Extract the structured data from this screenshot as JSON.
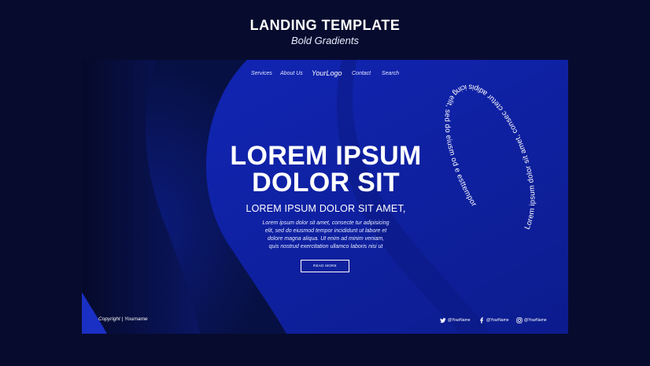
{
  "showcase": {
    "title": "LANDING TEMPLATE",
    "subtitle": "Bold Gradients"
  },
  "nav": {
    "items": [
      "Services",
      "About Us",
      "Contact",
      "Search"
    ],
    "logo": "YourLogo"
  },
  "hero": {
    "title_line1": "LOREM IPSUM",
    "title_line2": "DOLOR SIT",
    "subtitle": "LOREM IPSUM DOLOR SIT AMET,",
    "body_lines": [
      "Lorem ipsum dolor sit amet, consecte tur adipisicing",
      "elit, sed do eiusmod tempor incididunt ut labore et",
      "dolore magna aliqua. Ut enim ad minim veniam,",
      "quis nostrud exercitation ullamco laboris nisi ut"
    ],
    "cta_label": "READ MORE"
  },
  "ring_text": "Lorem ipsum dolor sit amet, consec ctetur adipis icing elit, sed do eiusm od e esttempor",
  "footer": {
    "copyright": "Copyright | Yourname",
    "socials": [
      {
        "icon": "twitter-icon",
        "handle": "@YourName"
      },
      {
        "icon": "facebook-icon",
        "handle": "@YourName"
      },
      {
        "icon": "instagram-icon",
        "handle": "@YourName"
      }
    ]
  },
  "colors": {
    "page_bg": "#070b2e",
    "frame_blue": "#0d1f96",
    "deep_navy": "#050a2a",
    "accent_blue": "#1a2fc4"
  }
}
